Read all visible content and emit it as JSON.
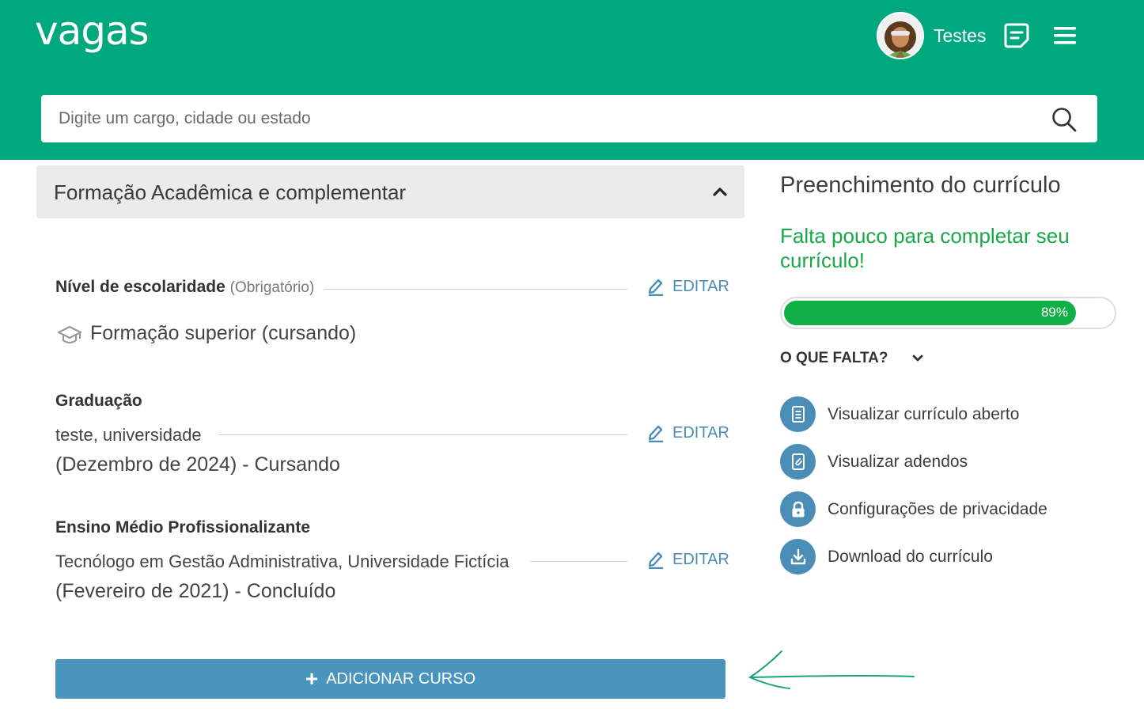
{
  "header": {
    "logo": "vagas",
    "user_name": "Testes",
    "search_placeholder": "Digite um cargo, cidade ou estado"
  },
  "section": {
    "title": "Formação Acadêmica e complementar",
    "edit_label": "EDITAR",
    "level": {
      "label": "Nível de escolaridade",
      "required": "(Obrigatório)",
      "value": "Formação superior (cursando)"
    },
    "entries": [
      {
        "label": "Graduação",
        "line1": "teste, universidade",
        "line2": "(Dezembro de 2024) - Cursando"
      },
      {
        "label": "Ensino Médio Profissionalizante",
        "line1": "Tecnólogo em Gestão Administrativa, Universidade Fictícia",
        "line2": "(Fevereiro de 2021) - Concluído"
      }
    ],
    "add_button": "ADICIONAR CURSO"
  },
  "sidebar": {
    "title": "Preenchimento do currículo",
    "message": "Falta pouco para completar seu currículo!",
    "progress_value": 89,
    "progress_label": "89%",
    "missing_label": "O QUE FALTA?",
    "links": [
      {
        "label": "Visualizar currículo aberto",
        "icon": "document-icon"
      },
      {
        "label": "Visualizar adendos",
        "icon": "attachment-icon"
      },
      {
        "label": "Configurações de privacidade",
        "icon": "lock-icon"
      },
      {
        "label": "Download do currículo",
        "icon": "download-icon"
      }
    ]
  },
  "colors": {
    "header": "#00a87e",
    "accent": "#4a8db7",
    "progress": "#11b046",
    "message": "#18a84a"
  }
}
